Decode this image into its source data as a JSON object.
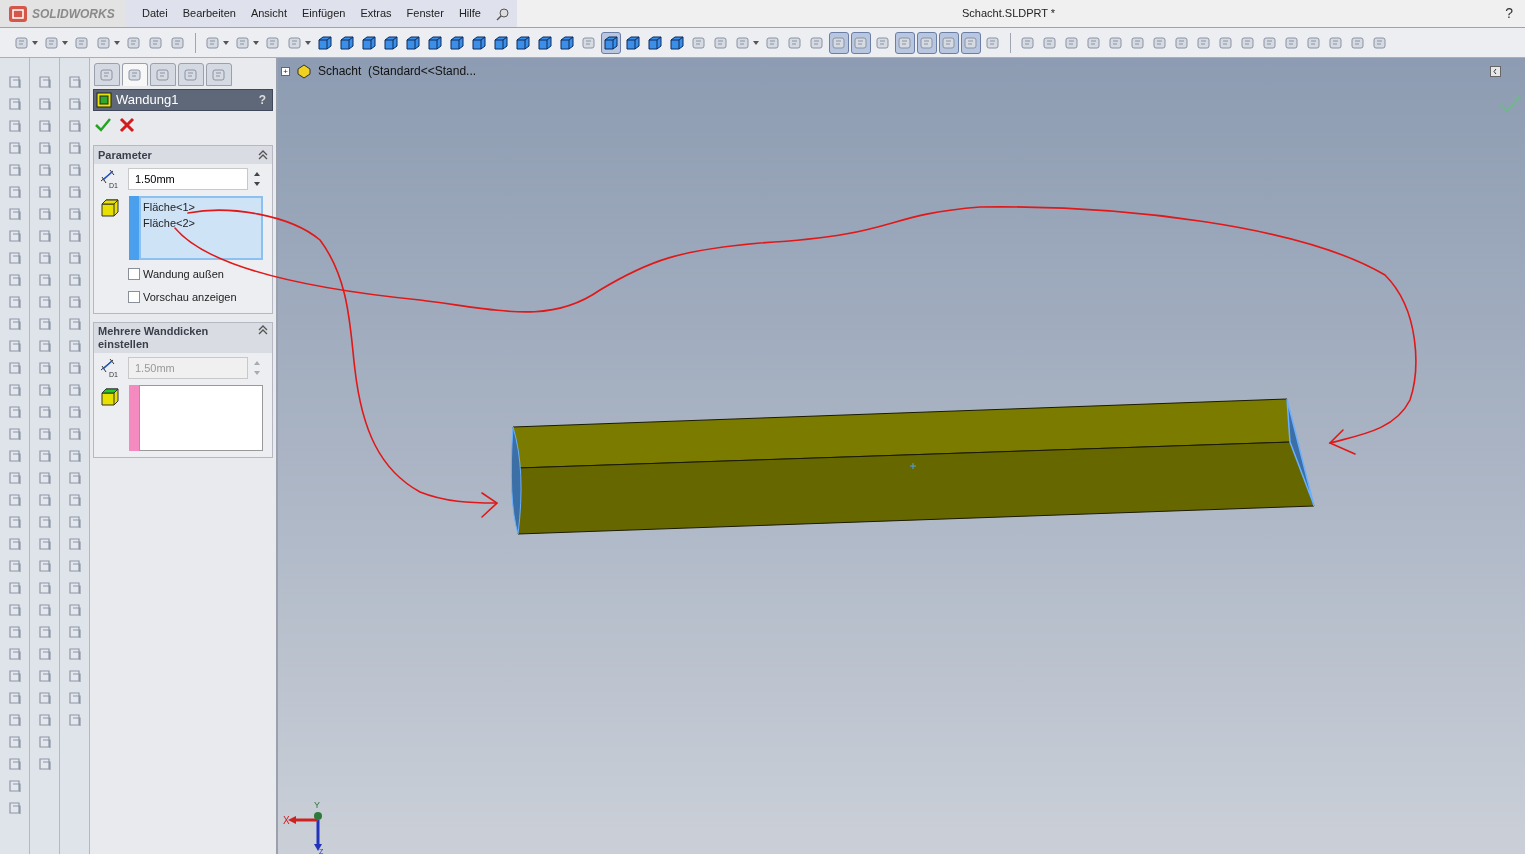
{
  "app": {
    "logo": "SOLIDWORKS",
    "menu": [
      "Datei",
      "Bearbeiten",
      "Ansicht",
      "Einfügen",
      "Extras",
      "Fenster",
      "Hilfe"
    ],
    "title": "Schacht.SLDPRT *",
    "help": "?"
  },
  "toolbar": [
    {
      "kind": "split",
      "on": false
    },
    {
      "kind": "split",
      "on": false
    },
    {
      "kind": "tool",
      "on": false
    },
    {
      "kind": "split",
      "on": false
    },
    {
      "kind": "tool",
      "on": false
    },
    {
      "kind": "tool",
      "on": false
    },
    {
      "kind": "tool",
      "on": false
    },
    {
      "kind": "sep"
    },
    {
      "kind": "split",
      "on": false
    },
    {
      "kind": "split",
      "on": false
    },
    {
      "kind": "tool",
      "on": false
    },
    {
      "kind": "split",
      "on": false
    },
    {
      "kind": "cube",
      "on": false
    },
    {
      "kind": "cube",
      "on": false
    },
    {
      "kind": "cube",
      "on": false
    },
    {
      "kind": "cube",
      "on": false
    },
    {
      "kind": "cube",
      "on": false
    },
    {
      "kind": "cube",
      "on": false
    },
    {
      "kind": "cube",
      "on": false
    },
    {
      "kind": "cube",
      "on": false
    },
    {
      "kind": "cube",
      "on": false
    },
    {
      "kind": "cube",
      "on": false
    },
    {
      "kind": "cube",
      "on": false
    },
    {
      "kind": "cube",
      "on": false
    },
    {
      "kind": "tool",
      "on": false
    },
    {
      "kind": "cube",
      "on": true
    },
    {
      "kind": "cube",
      "on": false
    },
    {
      "kind": "cube",
      "on": false
    },
    {
      "kind": "cube",
      "on": false
    },
    {
      "kind": "tool",
      "on": false
    },
    {
      "kind": "tool",
      "on": false
    },
    {
      "kind": "split",
      "on": false
    },
    {
      "kind": "tool",
      "on": false
    },
    {
      "kind": "tool",
      "on": false
    },
    {
      "kind": "tool",
      "on": false
    },
    {
      "kind": "tool",
      "on": true
    },
    {
      "kind": "tool",
      "on": true
    },
    {
      "kind": "tool",
      "on": false
    },
    {
      "kind": "tool",
      "on": true
    },
    {
      "kind": "tool",
      "on": true
    },
    {
      "kind": "tool",
      "on": true
    },
    {
      "kind": "tool",
      "on": true
    },
    {
      "kind": "tool",
      "on": false
    },
    {
      "kind": "sep"
    },
    {
      "kind": "tool",
      "on": false
    },
    {
      "kind": "tool",
      "on": false
    },
    {
      "kind": "tool",
      "on": false
    },
    {
      "kind": "tool",
      "on": false
    },
    {
      "kind": "tool",
      "on": false
    },
    {
      "kind": "tool",
      "on": false
    },
    {
      "kind": "tool",
      "on": false
    },
    {
      "kind": "tool",
      "on": false
    },
    {
      "kind": "tool",
      "on": false
    },
    {
      "kind": "tool",
      "on": false
    },
    {
      "kind": "tool",
      "on": false
    },
    {
      "kind": "tool",
      "on": false
    },
    {
      "kind": "tool",
      "on": false
    },
    {
      "kind": "tool",
      "on": false
    },
    {
      "kind": "tool",
      "on": false
    },
    {
      "kind": "tool",
      "on": false
    },
    {
      "kind": "tool",
      "on": false
    }
  ],
  "panel_tabs": [
    {
      "selected": false
    },
    {
      "selected": true
    },
    {
      "selected": false
    },
    {
      "selected": false
    },
    {
      "selected": false
    }
  ],
  "feature": {
    "title": "Wandung1",
    "help": "?"
  },
  "parameter": {
    "title": "Parameter",
    "expanded": true,
    "dim_label": "D1",
    "thickness": "1.50mm",
    "faces": [
      "Fläche<1>",
      "Fläche<2>"
    ],
    "options": [
      {
        "label": "Wandung außen",
        "checked": false
      },
      {
        "label": "Vorschau anzeigen",
        "checked": false
      }
    ]
  },
  "multi": {
    "title": "Mehrere Wanddicken einstellen",
    "expanded": true,
    "dim_label": "D1",
    "thickness": "1.50mm",
    "disabled": true
  },
  "tree": {
    "expander": "+",
    "label": "Schacht  (Standard<<Stand..."
  },
  "triad": {
    "x": "X",
    "y": "Y",
    "z": "Z"
  }
}
